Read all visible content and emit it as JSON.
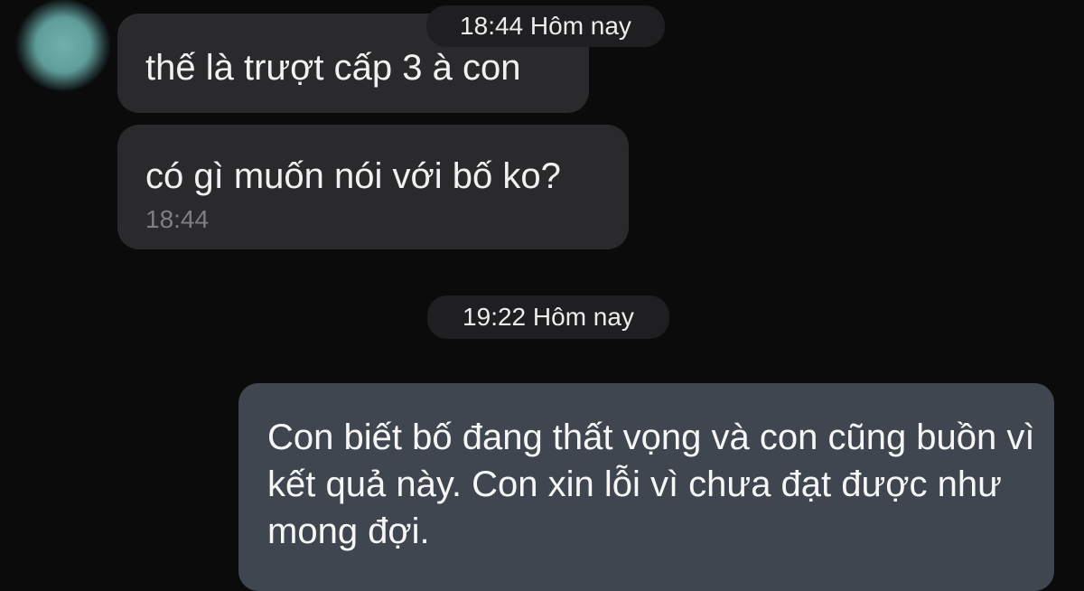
{
  "header": {
    "date_separator_1": "18:44 Hôm nay",
    "date_separator_2": "19:22 Hôm nay"
  },
  "messages": [
    {
      "direction": "incoming",
      "text": "thế là trượt cấp 3 à con"
    },
    {
      "direction": "incoming",
      "text": "có gì muốn nói với bố ko?",
      "time": "18:44"
    },
    {
      "direction": "outgoing",
      "text": "Con biết bố đang thất vọng và con cũng buồn vì kết quả này. Con xin lỗi vì chưa đạt được như mong đợi."
    }
  ],
  "colors": {
    "background": "#0b0b0c",
    "incoming_bubble": "#2a2a2c",
    "outgoing_bubble": "#3f464f",
    "avatar": "#6fb1ad"
  }
}
